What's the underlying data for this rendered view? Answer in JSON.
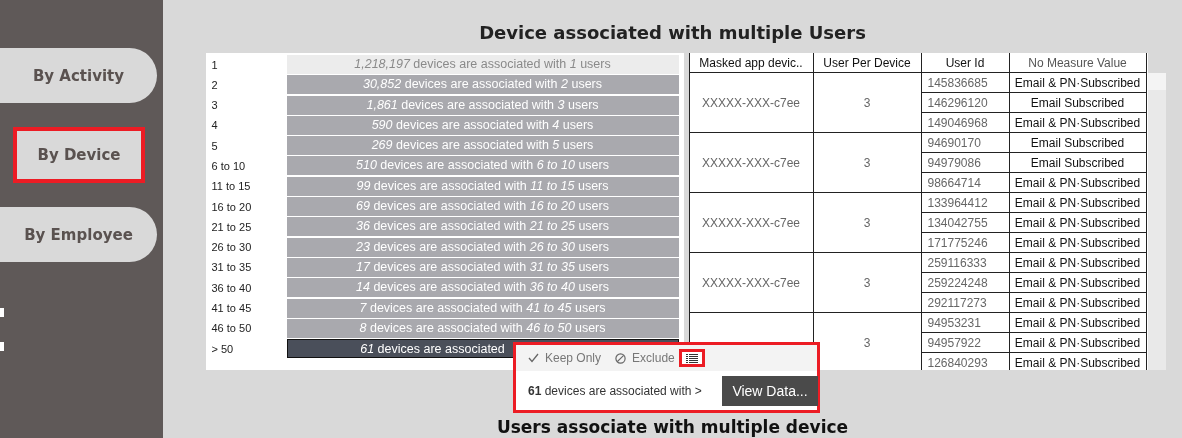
{
  "sidebar": {
    "items": [
      {
        "label": "By Activity",
        "selected": false
      },
      {
        "label": "By Device",
        "selected": true
      },
      {
        "label": "By Employee",
        "selected": false
      }
    ]
  },
  "title": "Device associated with multiple Users",
  "bar_list": {
    "rows": [
      {
        "label": "1",
        "text": "*1,218,197* devices are associated with *1* users",
        "selected": false,
        "faded": true
      },
      {
        "label": "2",
        "text": "*30,852* devices are associated with *2* users",
        "selected": false,
        "faded": false
      },
      {
        "label": "3",
        "text": "*1,861* devices are associated with *3* users",
        "selected": false,
        "faded": false
      },
      {
        "label": "4",
        "text": "*590* devices are associated with *4* users",
        "selected": false,
        "faded": false
      },
      {
        "label": "5",
        "text": "*269* devices are associated with *5* users",
        "selected": false,
        "faded": false
      },
      {
        "label": "6 to 10",
        "text": "*510* devices are associated with *6 to 10* users",
        "selected": false,
        "faded": false
      },
      {
        "label": "11 to 15",
        "text": "*99* devices are associated with *11 to 15* users",
        "selected": false,
        "faded": false
      },
      {
        "label": "16 to 20",
        "text": "*69* devices are associated with *16 to 20* users",
        "selected": false,
        "faded": false
      },
      {
        "label": "21 to 25",
        "text": "*36* devices are associated with *21 to 25* users",
        "selected": false,
        "faded": false
      },
      {
        "label": "26 to 30",
        "text": "*23* devices are associated with *26 to 30* users",
        "selected": false,
        "faded": false
      },
      {
        "label": "31 to 35",
        "text": "*17* devices are associated with *31 to 35* users",
        "selected": false,
        "faded": false
      },
      {
        "label": "36 to 40",
        "text": "*14* devices are associated with *36 to 40* users",
        "selected": false,
        "faded": false
      },
      {
        "label": "41 to 45",
        "text": "*7* devices are associated with *41 to 45* users",
        "selected": false,
        "faded": false
      },
      {
        "label": "46 to 50",
        "text": "*8* devices are associated with *46 to 50* users",
        "selected": false,
        "faded": false
      },
      {
        "label": "> 50",
        "text": "*61* devices are associated",
        "selected": true,
        "faded": false
      }
    ]
  },
  "table": {
    "columns": [
      "Masked app devic..",
      "User Per Device",
      "User Id",
      "No Measure Value"
    ],
    "groups": [
      {
        "device": "XXXXX-XXX-c7ee",
        "users_per_device": "3",
        "rows": [
          {
            "user_id": "145836685",
            "value": "Email & PN·Subscribed"
          },
          {
            "user_id": "146296120",
            "value": "Email Subscribed"
          },
          {
            "user_id": "149046968",
            "value": "Email & PN·Subscribed"
          }
        ]
      },
      {
        "device": "XXXXX-XXX-c7ee",
        "users_per_device": "3",
        "rows": [
          {
            "user_id": "94690170",
            "value": "Email Subscribed"
          },
          {
            "user_id": "94979086",
            "value": "Email Subscribed"
          },
          {
            "user_id": "98664714",
            "value": "Email & PN·Subscribed"
          }
        ]
      },
      {
        "device": "XXXXX-XXX-c7ee",
        "users_per_device": "3",
        "rows": [
          {
            "user_id": "133964412",
            "value": "Email & PN·Subscribed"
          },
          {
            "user_id": "134042755",
            "value": "Email & PN·Subscribed"
          },
          {
            "user_id": "171775246",
            "value": "Email & PN·Subscribed"
          }
        ]
      },
      {
        "device": "XXXXX-XXX-c7ee",
        "users_per_device": "3",
        "rows": [
          {
            "user_id": "259116333",
            "value": "Email & PN·Subscribed"
          },
          {
            "user_id": "259224248",
            "value": "Email & PN·Subscribed"
          },
          {
            "user_id": "292117273",
            "value": "Email & PN·Subscribed"
          }
        ]
      },
      {
        "users_per_device": "3",
        "rows": [
          {
            "user_id": "94953231",
            "value": "Email & PN·Subscribed"
          },
          {
            "user_id": "94957922",
            "value": "Email & PN·Subscribed"
          },
          {
            "user_id": "126840293",
            "value": "Email & PN·Subscribed"
          }
        ]
      }
    ]
  },
  "tooltip": {
    "keep_only": "Keep Only",
    "exclude": "Exclude",
    "summary": "**61** devices are associated with >",
    "view_data": "View Data..."
  },
  "bottom_title": "Users associate with multiple device"
}
